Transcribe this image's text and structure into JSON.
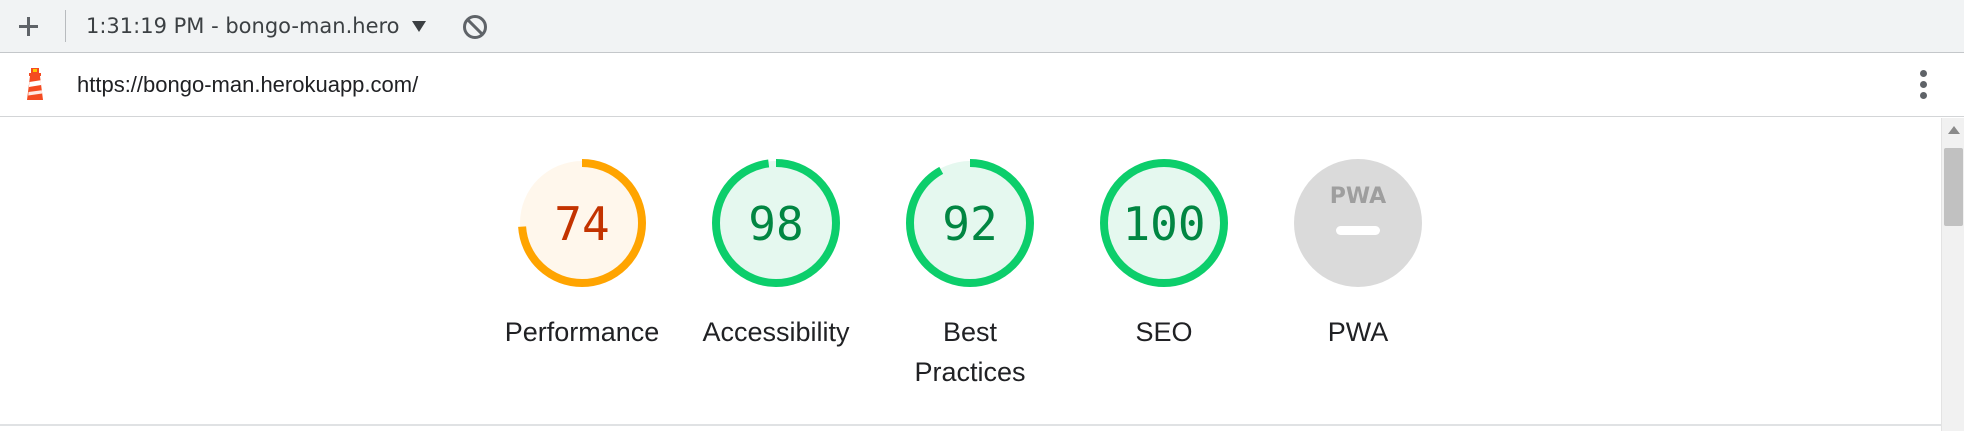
{
  "toolbar": {
    "add_icon": "plus-icon",
    "report_label": "1:31:19 PM - bongo-man.hero",
    "dropdown_icon": "caret-down-icon",
    "clear_icon": "block-icon"
  },
  "urlbar": {
    "logo_icon": "lighthouse-icon",
    "url": "https://bongo-man.herokuapp.com/",
    "menu_icon": "kebab-menu-icon"
  },
  "scores": [
    {
      "label": "Performance",
      "score": "74",
      "value": 74,
      "color": "#ffa400",
      "fill": "#fff7ec",
      "text_color": "#c33300"
    },
    {
      "label": "Accessibility",
      "score": "98",
      "value": 98,
      "color": "#0cce6b",
      "fill": "#e5f8ef",
      "text_color": "#018642"
    },
    {
      "label": "Best Practices",
      "score": "92",
      "value": 92,
      "color": "#0cce6b",
      "fill": "#e5f8ef",
      "text_color": "#018642"
    },
    {
      "label": "SEO",
      "score": "100",
      "value": 100,
      "color": "#0cce6b",
      "fill": "#e5f8ef",
      "text_color": "#018642"
    },
    {
      "label": "PWA",
      "badge": "PWA",
      "color": "#dadada",
      "icon": "pwa-badge-icon"
    }
  ]
}
